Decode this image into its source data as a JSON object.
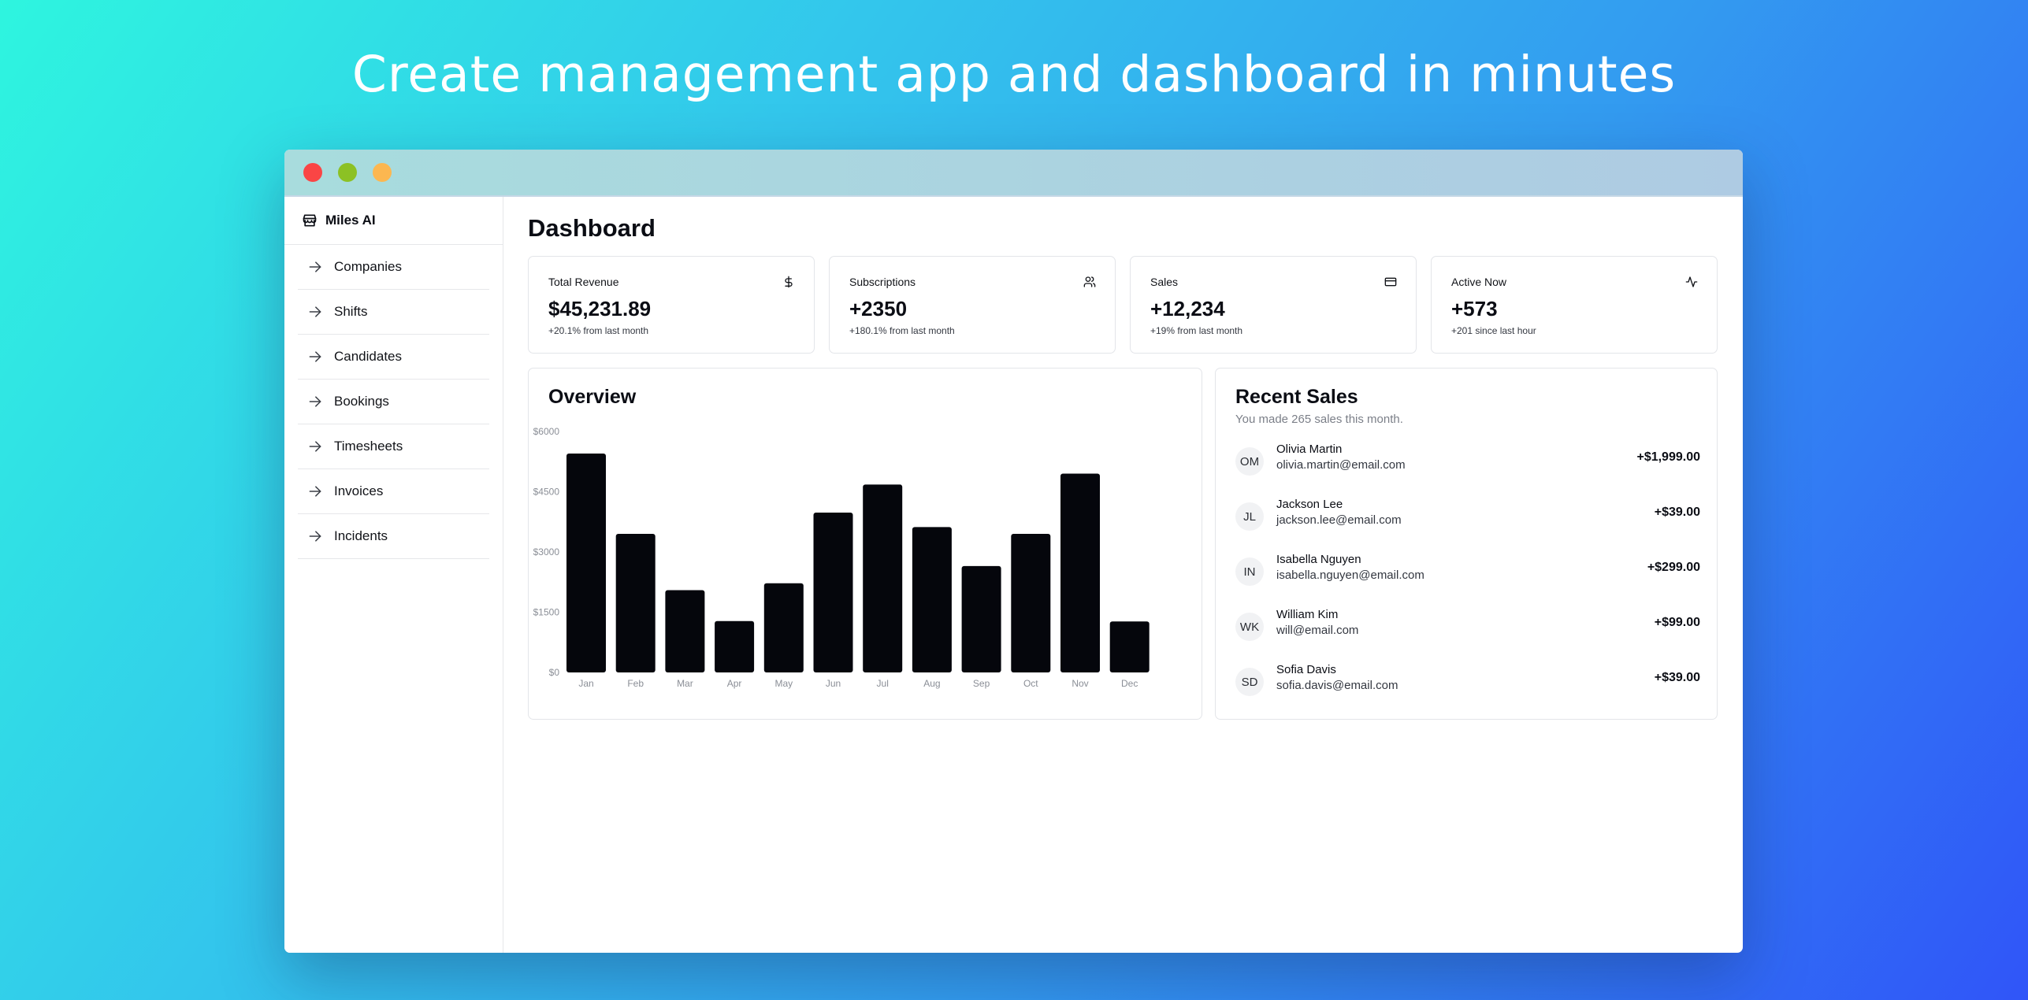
{
  "headline": "Create management app and dashboard in minutes",
  "colors": {
    "window_close": "#fa4545",
    "window_minimize": "#8cc124",
    "window_maximize": "#fcb750",
    "bar": "#05060c"
  },
  "sidebar": {
    "brand": "Miles AI",
    "brand_icon": "storefront-icon",
    "items": [
      {
        "label": "Companies",
        "icon": "arrow-right-icon"
      },
      {
        "label": "Shifts",
        "icon": "arrow-right-icon"
      },
      {
        "label": "Candidates",
        "icon": "arrow-right-icon"
      },
      {
        "label": "Bookings",
        "icon": "arrow-right-icon"
      },
      {
        "label": "Timesheets",
        "icon": "arrow-right-icon"
      },
      {
        "label": "Invoices",
        "icon": "arrow-right-icon"
      },
      {
        "label": "Incidents",
        "icon": "arrow-right-icon"
      }
    ]
  },
  "page": {
    "title": "Dashboard"
  },
  "stats": [
    {
      "label": "Total Revenue",
      "value": "$45,231.89",
      "sub": "+20.1% from last month",
      "icon": "dollar-icon"
    },
    {
      "label": "Subscriptions",
      "value": "+2350",
      "sub": "+180.1% from last month",
      "icon": "users-icon"
    },
    {
      "label": "Sales",
      "value": "+12,234",
      "sub": "+19% from last month",
      "icon": "credit-card-icon"
    },
    {
      "label": "Active Now",
      "value": "+573",
      "sub": "+201 since last hour",
      "icon": "activity-icon"
    }
  ],
  "overview": {
    "title": "Overview"
  },
  "chart_data": {
    "type": "bar",
    "title": "Overview",
    "categories": [
      "Jan",
      "Feb",
      "Mar",
      "Apr",
      "May",
      "Jun",
      "Jul",
      "Aug",
      "Sep",
      "Oct",
      "Nov",
      "Dec"
    ],
    "values": [
      5450,
      3450,
      2050,
      1280,
      2220,
      3980,
      4680,
      3620,
      2650,
      3450,
      4950,
      1270
    ],
    "y_ticks": [
      "$0",
      "$1500",
      "$3000",
      "$4500",
      "$6000"
    ],
    "ylim": [
      0,
      6000
    ],
    "xlabel": "",
    "ylabel": "",
    "grid": false
  },
  "recent_sales": {
    "title": "Recent Sales",
    "subtitle": "You made 265 sales this month.",
    "items": [
      {
        "initials": "OM",
        "name": "Olivia Martin",
        "email": "olivia.martin@email.com",
        "amount": "+$1,999.00"
      },
      {
        "initials": "JL",
        "name": "Jackson Lee",
        "email": "jackson.lee@email.com",
        "amount": "+$39.00"
      },
      {
        "initials": "IN",
        "name": "Isabella Nguyen",
        "email": "isabella.nguyen@email.com",
        "amount": "+$299.00"
      },
      {
        "initials": "WK",
        "name": "William Kim",
        "email": "will@email.com",
        "amount": "+$99.00"
      },
      {
        "initials": "SD",
        "name": "Sofia Davis",
        "email": "sofia.davis@email.com",
        "amount": "+$39.00"
      }
    ]
  }
}
